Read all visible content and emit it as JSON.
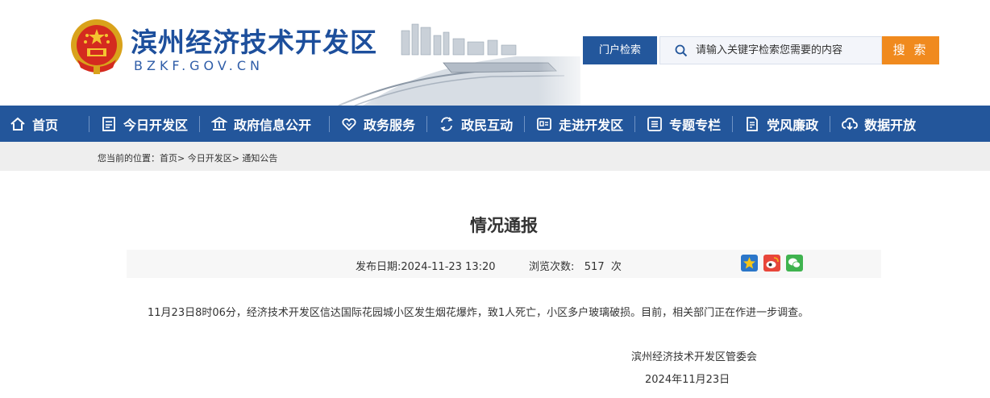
{
  "header": {
    "site_title": "滨州经济技术开发区",
    "site_domain": "BZKF.GOV.CN"
  },
  "search": {
    "scope_label": "门户检索",
    "placeholder": "请输入关键字检索您需要的内容",
    "button_label": "搜 索"
  },
  "nav": {
    "items": [
      {
        "label": "首页",
        "icon": "home-icon"
      },
      {
        "label": "今日开发区",
        "icon": "news-icon"
      },
      {
        "label": "政府信息公开",
        "icon": "building-icon"
      },
      {
        "label": "政务服务",
        "icon": "handshake-icon"
      },
      {
        "label": "政民互动",
        "icon": "interaction-icon"
      },
      {
        "label": "走进开发区",
        "icon": "profile-card-icon"
      },
      {
        "label": "专题专栏",
        "icon": "list-icon"
      },
      {
        "label": "党风廉政",
        "icon": "document-pen-icon"
      },
      {
        "label": "数据开放",
        "icon": "cloud-download-icon"
      }
    ]
  },
  "breadcrumb": {
    "text": "您当前的位置：首页> 今日开发区> 通知公告"
  },
  "article": {
    "title": "情况通报",
    "publish_date": "发布日期:2024-11-23 13:20",
    "views": "浏览次数:   517  次",
    "body": "11月23日8时06分，经济技术开发区信达国际花园城小区发生烟花爆炸，致1人死亡，小区多户玻璃破损。目前，相关部门正在作进一步调查。",
    "sign_org": "滨州经济技术开发区管委会",
    "sign_date": "2024年11月23日"
  },
  "colors": {
    "nav_bg": "#23569b",
    "accent_orange": "#f08a1e",
    "title_blue": "#1d4f9c"
  }
}
